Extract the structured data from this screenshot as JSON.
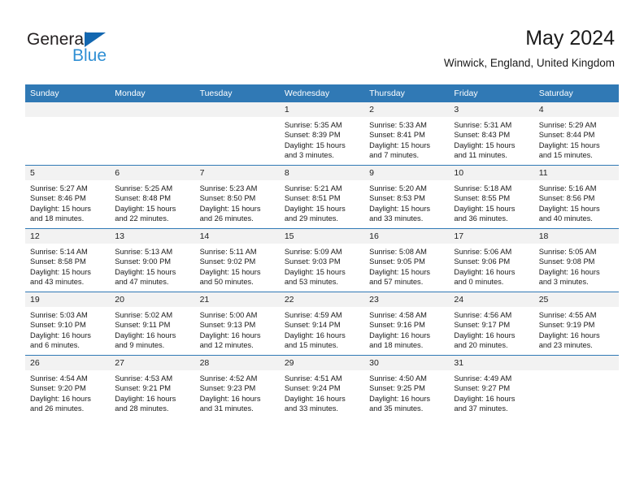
{
  "brand": {
    "name_top": "General",
    "name_bottom": "Blue",
    "triangle_color": "#1367b0",
    "blue_text_color": "#2f8fd4",
    "dark_text_color": "#231f20"
  },
  "header": {
    "title": "May 2024",
    "subtitle": "Winwick, England, United Kingdom"
  },
  "theme": {
    "header_blue": "#3079b5",
    "daynum_gray": "#f2f2f2",
    "cell_white": "#ffffff"
  },
  "calendar": {
    "weekday_headers": [
      "Sunday",
      "Monday",
      "Tuesday",
      "Wednesday",
      "Thursday",
      "Friday",
      "Saturday"
    ],
    "weeks": [
      [
        {
          "day": "",
          "lines": []
        },
        {
          "day": "",
          "lines": []
        },
        {
          "day": "",
          "lines": []
        },
        {
          "day": "1",
          "lines": [
            "Sunrise: 5:35 AM",
            "Sunset: 8:39 PM",
            "Daylight: 15 hours",
            "and 3 minutes."
          ]
        },
        {
          "day": "2",
          "lines": [
            "Sunrise: 5:33 AM",
            "Sunset: 8:41 PM",
            "Daylight: 15 hours",
            "and 7 minutes."
          ]
        },
        {
          "day": "3",
          "lines": [
            "Sunrise: 5:31 AM",
            "Sunset: 8:43 PM",
            "Daylight: 15 hours",
            "and 11 minutes."
          ]
        },
        {
          "day": "4",
          "lines": [
            "Sunrise: 5:29 AM",
            "Sunset: 8:44 PM",
            "Daylight: 15 hours",
            "and 15 minutes."
          ]
        }
      ],
      [
        {
          "day": "5",
          "lines": [
            "Sunrise: 5:27 AM",
            "Sunset: 8:46 PM",
            "Daylight: 15 hours",
            "and 18 minutes."
          ]
        },
        {
          "day": "6",
          "lines": [
            "Sunrise: 5:25 AM",
            "Sunset: 8:48 PM",
            "Daylight: 15 hours",
            "and 22 minutes."
          ]
        },
        {
          "day": "7",
          "lines": [
            "Sunrise: 5:23 AM",
            "Sunset: 8:50 PM",
            "Daylight: 15 hours",
            "and 26 minutes."
          ]
        },
        {
          "day": "8",
          "lines": [
            "Sunrise: 5:21 AM",
            "Sunset: 8:51 PM",
            "Daylight: 15 hours",
            "and 29 minutes."
          ]
        },
        {
          "day": "9",
          "lines": [
            "Sunrise: 5:20 AM",
            "Sunset: 8:53 PM",
            "Daylight: 15 hours",
            "and 33 minutes."
          ]
        },
        {
          "day": "10",
          "lines": [
            "Sunrise: 5:18 AM",
            "Sunset: 8:55 PM",
            "Daylight: 15 hours",
            "and 36 minutes."
          ]
        },
        {
          "day": "11",
          "lines": [
            "Sunrise: 5:16 AM",
            "Sunset: 8:56 PM",
            "Daylight: 15 hours",
            "and 40 minutes."
          ]
        }
      ],
      [
        {
          "day": "12",
          "lines": [
            "Sunrise: 5:14 AM",
            "Sunset: 8:58 PM",
            "Daylight: 15 hours",
            "and 43 minutes."
          ]
        },
        {
          "day": "13",
          "lines": [
            "Sunrise: 5:13 AM",
            "Sunset: 9:00 PM",
            "Daylight: 15 hours",
            "and 47 minutes."
          ]
        },
        {
          "day": "14",
          "lines": [
            "Sunrise: 5:11 AM",
            "Sunset: 9:02 PM",
            "Daylight: 15 hours",
            "and 50 minutes."
          ]
        },
        {
          "day": "15",
          "lines": [
            "Sunrise: 5:09 AM",
            "Sunset: 9:03 PM",
            "Daylight: 15 hours",
            "and 53 minutes."
          ]
        },
        {
          "day": "16",
          "lines": [
            "Sunrise: 5:08 AM",
            "Sunset: 9:05 PM",
            "Daylight: 15 hours",
            "and 57 minutes."
          ]
        },
        {
          "day": "17",
          "lines": [
            "Sunrise: 5:06 AM",
            "Sunset: 9:06 PM",
            "Daylight: 16 hours",
            "and 0 minutes."
          ]
        },
        {
          "day": "18",
          "lines": [
            "Sunrise: 5:05 AM",
            "Sunset: 9:08 PM",
            "Daylight: 16 hours",
            "and 3 minutes."
          ]
        }
      ],
      [
        {
          "day": "19",
          "lines": [
            "Sunrise: 5:03 AM",
            "Sunset: 9:10 PM",
            "Daylight: 16 hours",
            "and 6 minutes."
          ]
        },
        {
          "day": "20",
          "lines": [
            "Sunrise: 5:02 AM",
            "Sunset: 9:11 PM",
            "Daylight: 16 hours",
            "and 9 minutes."
          ]
        },
        {
          "day": "21",
          "lines": [
            "Sunrise: 5:00 AM",
            "Sunset: 9:13 PM",
            "Daylight: 16 hours",
            "and 12 minutes."
          ]
        },
        {
          "day": "22",
          "lines": [
            "Sunrise: 4:59 AM",
            "Sunset: 9:14 PM",
            "Daylight: 16 hours",
            "and 15 minutes."
          ]
        },
        {
          "day": "23",
          "lines": [
            "Sunrise: 4:58 AM",
            "Sunset: 9:16 PM",
            "Daylight: 16 hours",
            "and 18 minutes."
          ]
        },
        {
          "day": "24",
          "lines": [
            "Sunrise: 4:56 AM",
            "Sunset: 9:17 PM",
            "Daylight: 16 hours",
            "and 20 minutes."
          ]
        },
        {
          "day": "25",
          "lines": [
            "Sunrise: 4:55 AM",
            "Sunset: 9:19 PM",
            "Daylight: 16 hours",
            "and 23 minutes."
          ]
        }
      ],
      [
        {
          "day": "26",
          "lines": [
            "Sunrise: 4:54 AM",
            "Sunset: 9:20 PM",
            "Daylight: 16 hours",
            "and 26 minutes."
          ]
        },
        {
          "day": "27",
          "lines": [
            "Sunrise: 4:53 AM",
            "Sunset: 9:21 PM",
            "Daylight: 16 hours",
            "and 28 minutes."
          ]
        },
        {
          "day": "28",
          "lines": [
            "Sunrise: 4:52 AM",
            "Sunset: 9:23 PM",
            "Daylight: 16 hours",
            "and 31 minutes."
          ]
        },
        {
          "day": "29",
          "lines": [
            "Sunrise: 4:51 AM",
            "Sunset: 9:24 PM",
            "Daylight: 16 hours",
            "and 33 minutes."
          ]
        },
        {
          "day": "30",
          "lines": [
            "Sunrise: 4:50 AM",
            "Sunset: 9:25 PM",
            "Daylight: 16 hours",
            "and 35 minutes."
          ]
        },
        {
          "day": "31",
          "lines": [
            "Sunrise: 4:49 AM",
            "Sunset: 9:27 PM",
            "Daylight: 16 hours",
            "and 37 minutes."
          ]
        },
        {
          "day": "",
          "lines": []
        }
      ]
    ]
  }
}
